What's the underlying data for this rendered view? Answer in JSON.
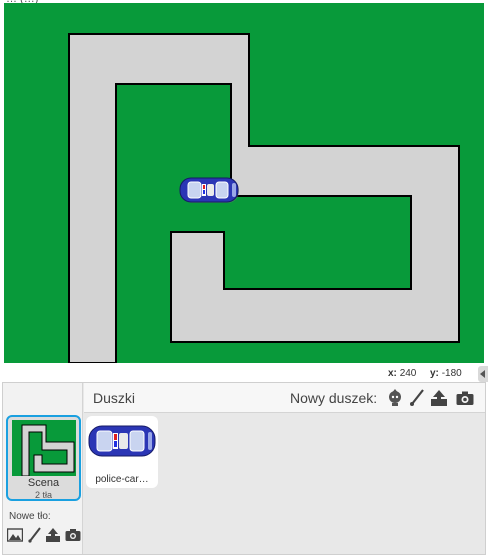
{
  "stage": {
    "caption": "… (…)",
    "background_color": "#089a3a",
    "track_color": "#d3d3d3",
    "sprite": {
      "name": "police-car",
      "icon": "police-car-icon"
    }
  },
  "coords": {
    "x_label": "x:",
    "x_value": "240",
    "y_label": "y:",
    "y_value": "-180"
  },
  "sprites_panel": {
    "title": "Duszki",
    "new_sprite_label": "Nowy duszek:",
    "new_sprite_icons": [
      "sprite-library-icon",
      "paint-brush-icon",
      "upload-icon",
      "camera-icon"
    ],
    "sprites": [
      {
        "name": "police-car…"
      }
    ]
  },
  "stage_panel": {
    "label": "Scena",
    "sublabel": "2 tła",
    "new_backdrop_label": "Nowe tło:",
    "new_backdrop_icons": [
      "backdrop-library-icon",
      "paint-brush-icon",
      "upload-icon",
      "camera-icon"
    ],
    "accent_color": "#1aa0e0"
  }
}
